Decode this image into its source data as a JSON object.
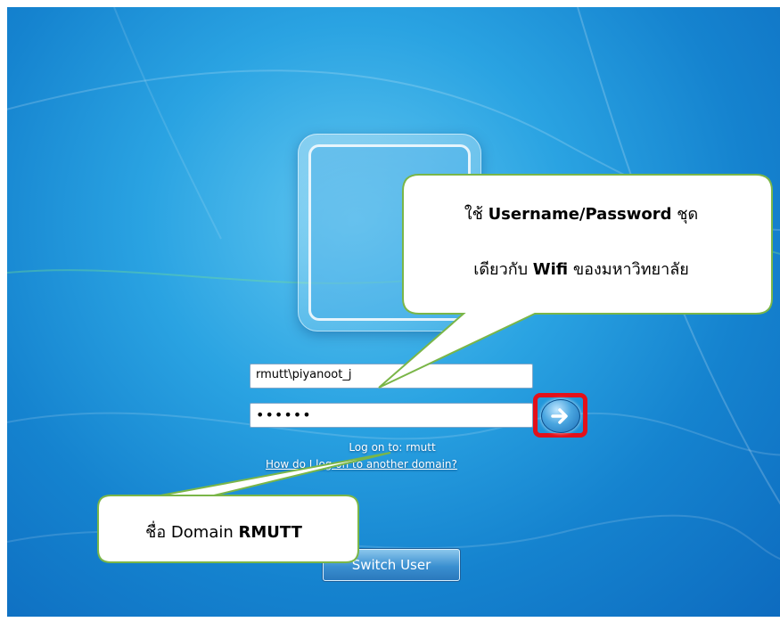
{
  "login": {
    "username_value": "rmutt\\piyanoot_j",
    "password_mask": "••••••",
    "logon_to": "Log on to: rmutt",
    "other_domain_link": "How do I log on to another domain?",
    "switch_user_label": "Switch User"
  },
  "callouts": {
    "credentials": {
      "line1_prefix": "ใช้ ",
      "line1_bold": "Username/Password",
      "line1_suffix": " ชุด",
      "line2_prefix": "เดียวกับ ",
      "line2_bold": "Wifi",
      "line2_suffix": " ของมหาวิทยาลัย"
    },
    "domain": {
      "prefix": "ชื่อ Domain ",
      "bold": "RMUTT"
    }
  },
  "colors": {
    "highlight": "#e3101a",
    "callout_fill": "#ffffff",
    "callout_border": "#7ab648"
  },
  "icons": {
    "submit": "right-arrow-icon"
  }
}
